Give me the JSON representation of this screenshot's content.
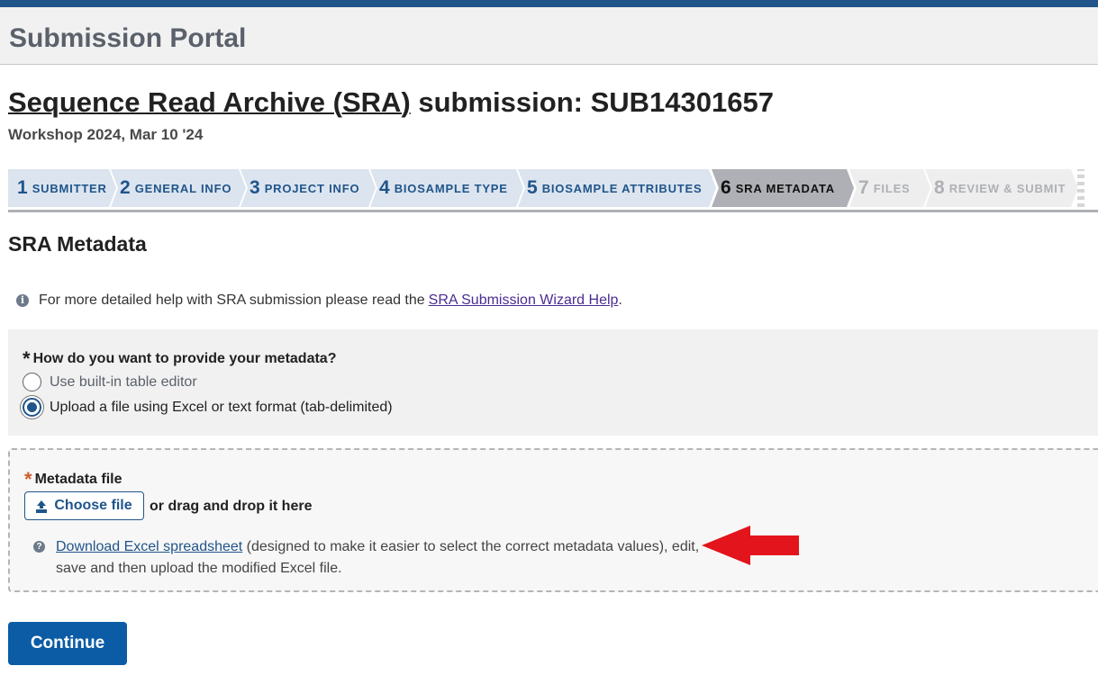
{
  "header": {
    "portal_title": "Submission Portal"
  },
  "page": {
    "heading_link": "Sequence Read Archive (SRA)",
    "heading_rest": " submission: SUB14301657",
    "subtitle": "Workshop 2024, Mar 10 '24"
  },
  "wizard": {
    "steps": [
      {
        "num": "1",
        "label": "SUBMITTER",
        "state": "done"
      },
      {
        "num": "2",
        "label": "GENERAL INFO",
        "state": "done"
      },
      {
        "num": "3",
        "label": "PROJECT INFO",
        "state": "done"
      },
      {
        "num": "4",
        "label": "BIOSAMPLE TYPE",
        "state": "done"
      },
      {
        "num": "5",
        "label": "BIOSAMPLE ATTRIBUTES",
        "state": "done"
      },
      {
        "num": "6",
        "label": "SRA METADATA",
        "state": "active"
      },
      {
        "num": "7",
        "label": "FILES",
        "state": "todo"
      },
      {
        "num": "8",
        "label": "REVIEW & SUBMIT",
        "state": "todo"
      }
    ]
  },
  "section": {
    "title": "SRA Metadata",
    "help_prefix": "For more detailed help with SRA submission please read the ",
    "help_link": "SRA Submission Wizard Help",
    "help_suffix": "."
  },
  "metadata_choice": {
    "required_mark": "*",
    "question": "How do you want to provide your metadata?",
    "options": [
      {
        "label": "Use built-in table editor",
        "checked": false
      },
      {
        "label": "Upload a file using Excel or text format (tab-delimited)",
        "checked": true
      }
    ]
  },
  "file_upload": {
    "required_mark": "*",
    "label": "Metadata file",
    "choose_button": "Choose file",
    "drag_text": "or drag and drop it here",
    "download_link": "Download Excel spreadsheet",
    "download_note": " (designed to make it easier to select the correct metadata values), edit, save and then upload the modified Excel file."
  },
  "actions": {
    "continue_label": "Continue"
  },
  "colors": {
    "brand_blue": "#20558a",
    "continue_blue": "#0b5ca5",
    "link_purple": "#4c2c92",
    "annotation_arrow": "#e3141b",
    "required_red": "#cd5c2e"
  },
  "icons": {
    "info": "info-circle-icon",
    "help": "question-circle-icon",
    "upload": "upload-icon",
    "annotation": "red-arrow-left"
  }
}
